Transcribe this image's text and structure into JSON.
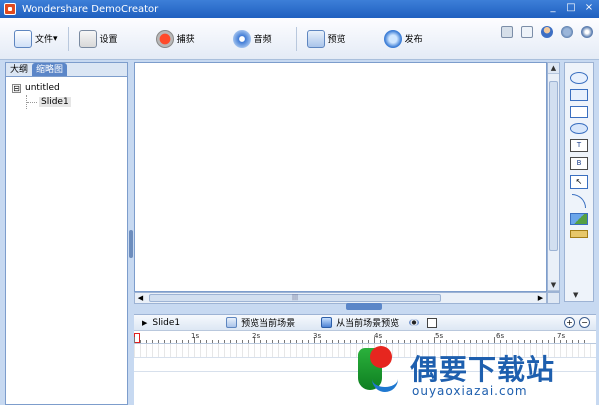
{
  "window": {
    "title": "Wondershare DemoCreator",
    "controls": [
      "_",
      "□",
      "×"
    ]
  },
  "toolbar": {
    "items": [
      {
        "label": "文件",
        "icon": "file-icon"
      },
      {
        "label": "设置",
        "icon": "settings-icon"
      },
      {
        "label": "捕获",
        "icon": "capture-icon"
      },
      {
        "label": "音频",
        "icon": "audio-icon"
      },
      {
        "label": "预览",
        "icon": "preview-icon"
      },
      {
        "label": "发布",
        "icon": "publish-icon"
      }
    ],
    "file_arrow": "▾",
    "right_icons": [
      "save-icon",
      "document-icon",
      "user-icon",
      "help-icon",
      "info-icon"
    ]
  },
  "left_panel": {
    "tabs": [
      "大纲",
      "缩略图"
    ],
    "active_tab": "缩略图",
    "tree": {
      "expander": "⊟",
      "root": "untitled",
      "children": [
        "Slide1"
      ]
    }
  },
  "scroll": {
    "up": "▲",
    "down": "▼",
    "left": "◀",
    "right": "▶",
    "grip": "|||"
  },
  "tools": [
    "callout-oval-icon",
    "callout-rect-icon",
    "rectangle-icon",
    "ellipse-icon",
    "textbox-icon",
    "hotspot-icon",
    "cursor-icon",
    "line-icon",
    "image-icon",
    "more-icon"
  ],
  "tool_text": {
    "textbox": "T",
    "hotspot": "B",
    "cursor": "↖"
  },
  "timeline": {
    "play": "▶",
    "slide_label": "Slide1",
    "preview_current": "预览当前场景",
    "preview_from_current": "从当前场景预览",
    "zoom_in": "+",
    "zoom_out": "−",
    "ruler_labels": [
      "1s",
      "2s",
      "3s",
      "4s",
      "5s",
      "6s",
      "7s"
    ]
  },
  "watermark": {
    "text": "偶要下载站",
    "url": "ouyaoxiazai.com"
  }
}
